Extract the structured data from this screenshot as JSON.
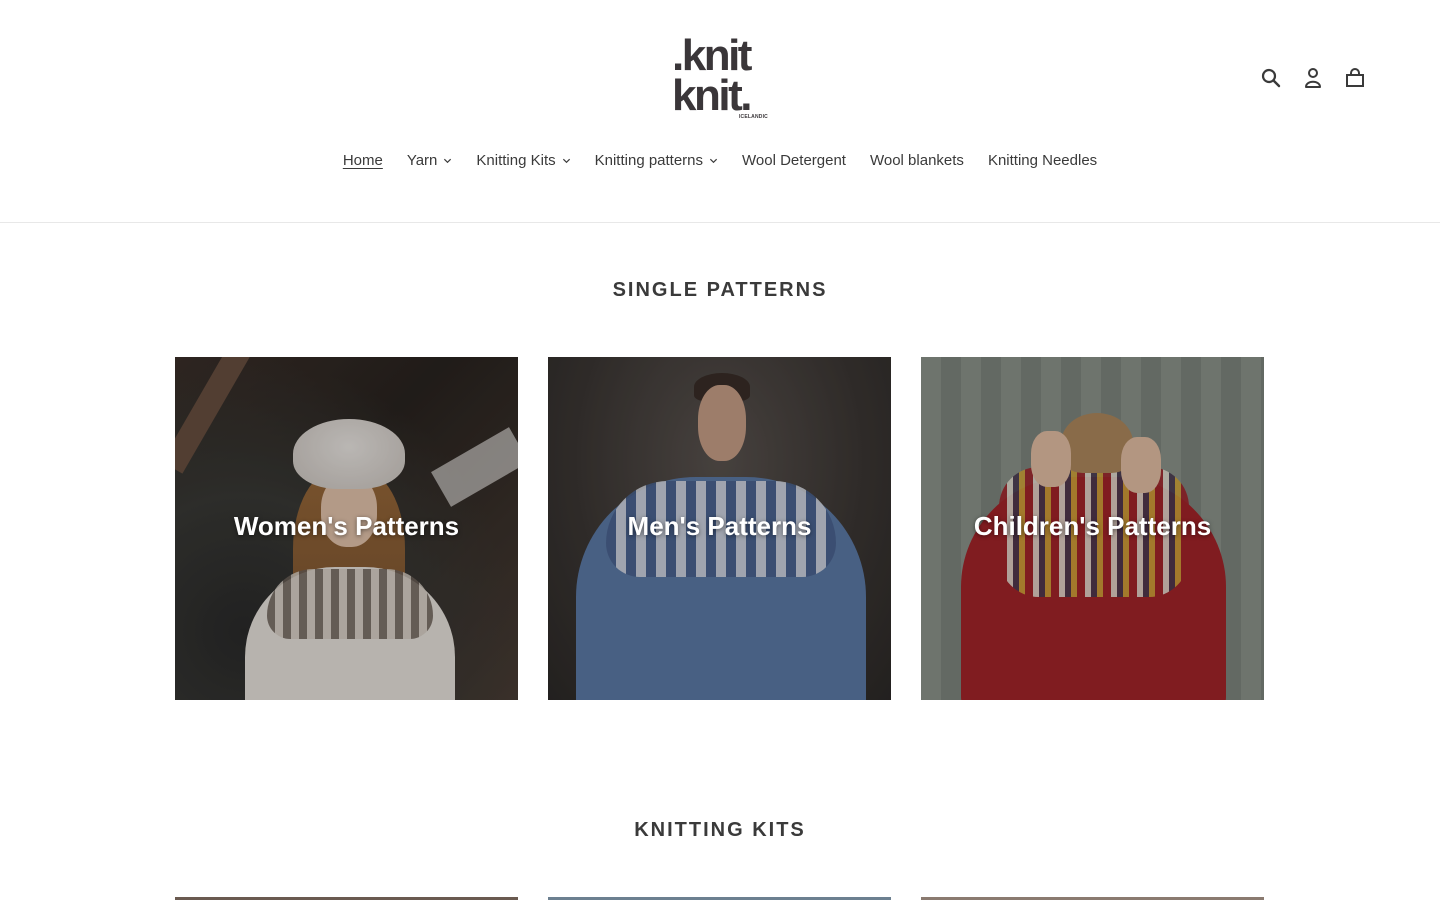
{
  "header": {
    "logo": {
      "line1": ".knit",
      "line2": "knit.",
      "tagline": "ICELANDIC"
    },
    "icons": [
      {
        "name": "search-icon"
      },
      {
        "name": "account-icon"
      },
      {
        "name": "cart-icon"
      }
    ]
  },
  "nav": {
    "items": [
      {
        "label": "Home",
        "active": true,
        "dropdown": false
      },
      {
        "label": "Yarn",
        "active": false,
        "dropdown": true
      },
      {
        "label": "Knitting Kits",
        "active": false,
        "dropdown": true
      },
      {
        "label": "Knitting patterns",
        "active": false,
        "dropdown": true
      },
      {
        "label": "Wool Detergent",
        "active": false,
        "dropdown": false
      },
      {
        "label": "Wool blankets",
        "active": false,
        "dropdown": false
      },
      {
        "label": "Knitting Needles",
        "active": false,
        "dropdown": false
      }
    ]
  },
  "single_patterns": {
    "title": "SINGLE PATTERNS",
    "cards": [
      {
        "title": "Women's Patterns"
      },
      {
        "title": "Men's Patterns"
      },
      {
        "title": "Children's Patterns"
      }
    ]
  },
  "knitting_kits": {
    "title": "KNITTING KITS"
  },
  "colors": {
    "text": "#3a3a3a",
    "background": "#ffffff",
    "border": "#e8e8e8"
  }
}
